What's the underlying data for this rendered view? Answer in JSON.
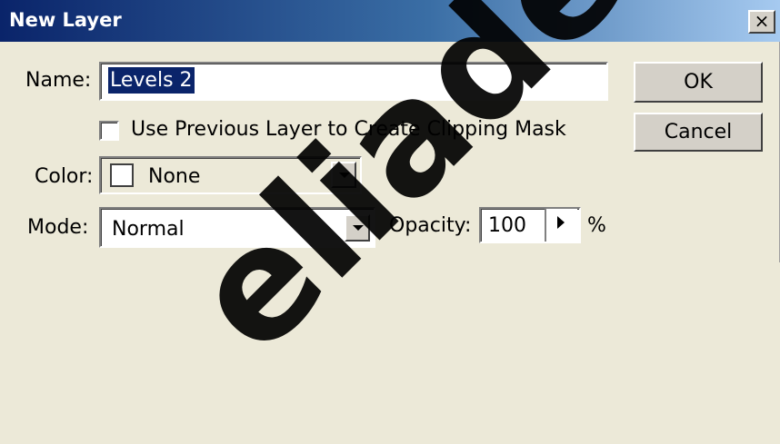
{
  "window": {
    "title": "New Layer",
    "close_label": "×"
  },
  "form": {
    "name_label": "Name:",
    "name_value": "Levels 2",
    "clipping_label": "Use Previous Layer to Create Clipping Mask",
    "clipping_checked": false,
    "color_label": "Color:",
    "color_value": "None",
    "mode_label": "Mode:",
    "mode_value": "Normal",
    "opacity_label": "Opacity:",
    "opacity_value": "100",
    "opacity_unit": "%"
  },
  "buttons": {
    "ok": "OK",
    "cancel": "Cancel"
  },
  "icons": {
    "close": "close-icon",
    "dropdown": "chevron-down-icon",
    "slider": "triangle-right-icon"
  },
  "watermark": {
    "text": "eliade"
  }
}
